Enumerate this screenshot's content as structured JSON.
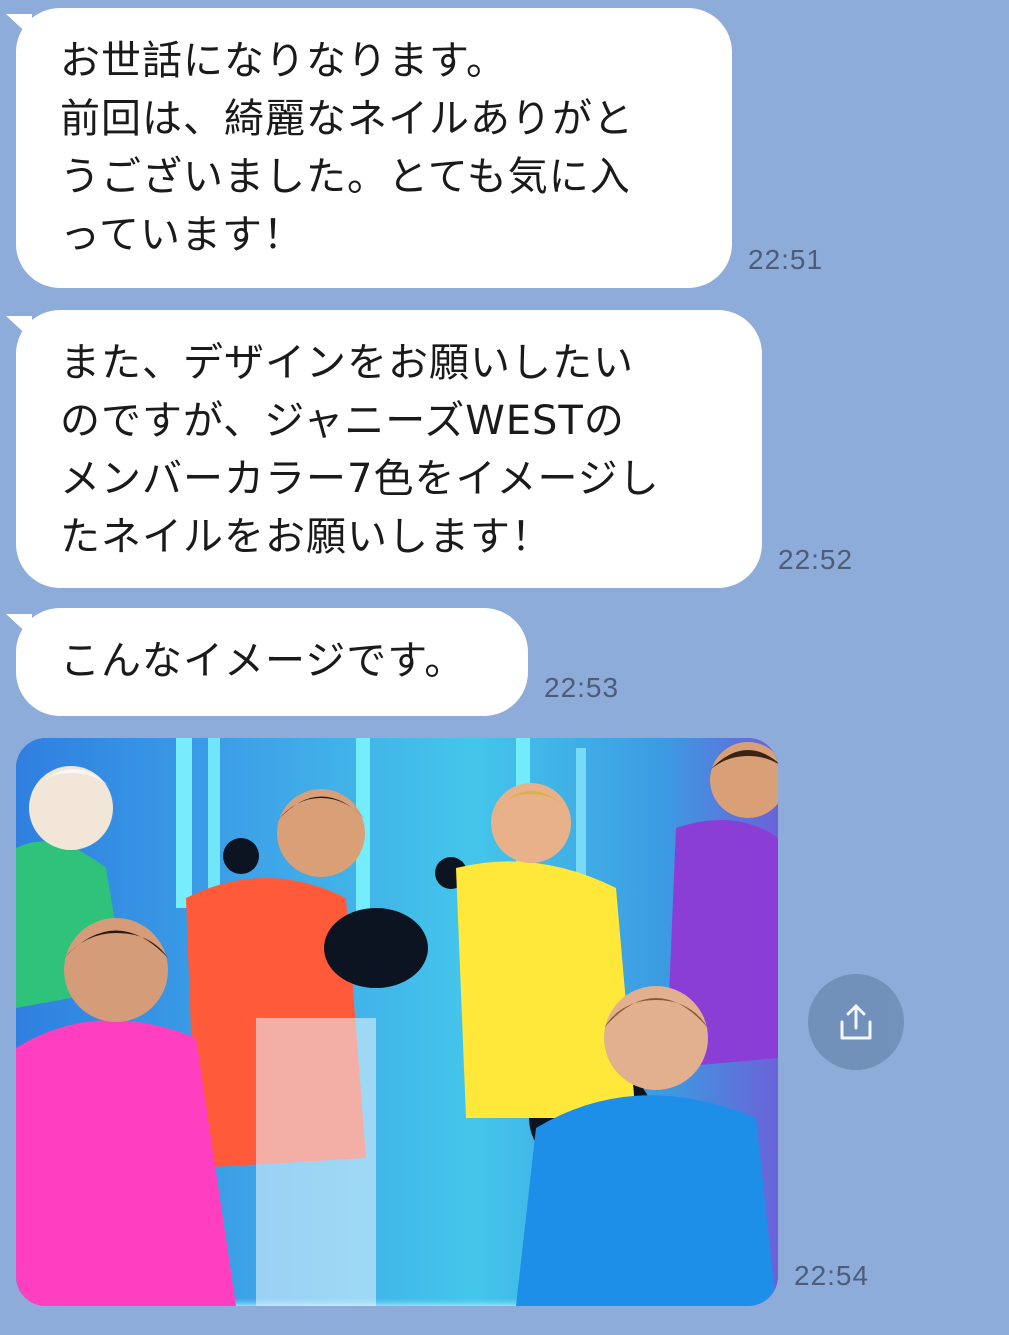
{
  "messages": [
    {
      "lines": [
        "お世話になりなります。",
        "前回は、綺麗なネイルありがと",
        "うございました。とても気に入",
        "っています！"
      ],
      "time": "22:51"
    },
    {
      "lines": [
        "また、デザインをお願いしたい",
        "のですが、ジャニーズWESTの",
        "メンバーカラー7色をイメージし",
        "たネイルをお願いします！"
      ],
      "time": "22:52"
    },
    {
      "lines": [
        "こんなイメージです。"
      ],
      "time": "22:53"
    }
  ],
  "photo_message": {
    "time": "22:54",
    "share_icon": "share-icon"
  },
  "colors": {
    "background": "#8dacd9",
    "bubble": "#ffffff",
    "text": "#1a1a1a",
    "timestamp": "#4d5d78",
    "share_button": "#6f8fb8"
  }
}
